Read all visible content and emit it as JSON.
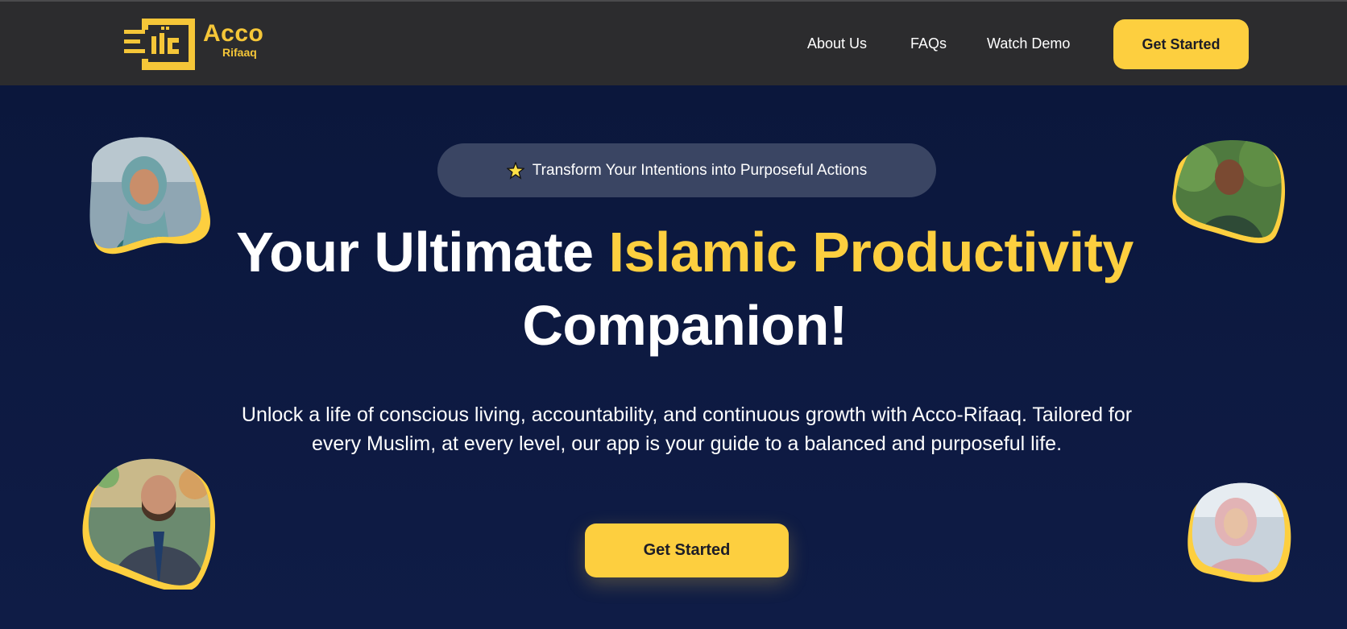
{
  "brand": {
    "logo_text": "Acco",
    "logo_subtext": "Rifaaq",
    "accent_color": "#fdcf3f",
    "header_color": "#2c2c2e",
    "hero_color": "#0d1a3f"
  },
  "nav": {
    "items": [
      {
        "label": "About Us"
      },
      {
        "label": "FAQs"
      },
      {
        "label": "Watch Demo"
      }
    ],
    "cta_label": "Get Started"
  },
  "hero": {
    "badge_icon": "star-icon",
    "badge_text": "Transform Your Intentions into Purposeful Actions",
    "headline_part1": "Your Ultimate ",
    "headline_accent": "Islamic Productivity",
    "headline_part2": "Companion!",
    "description": "Unlock a life of conscious living, accountability, and continuous growth with Acco-Rifaaq. Tailored for every Muslim, at every level, our app is your guide to a balanced and purposeful life.",
    "cta_label": "Get Started"
  },
  "avatars": [
    {
      "name": "avatar-woman-hijab-teal",
      "icon": "person-photo"
    },
    {
      "name": "avatar-man-green-hoodie",
      "icon": "person-photo"
    },
    {
      "name": "avatar-man-glasses-suit",
      "icon": "person-photo"
    },
    {
      "name": "avatar-woman-pink-hijab",
      "icon": "person-photo"
    }
  ]
}
